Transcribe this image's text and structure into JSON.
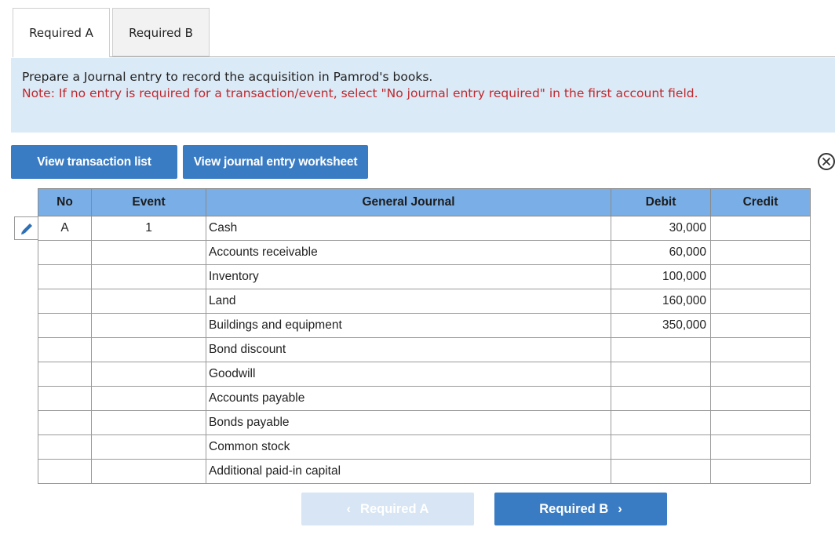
{
  "tabs": [
    {
      "label": "Required A",
      "active": true
    },
    {
      "label": "Required B",
      "active": false
    }
  ],
  "instructions": {
    "main": "Prepare a Journal entry to record the acquisition in Pamrod's books.",
    "note": "Note: If no entry is required for a transaction/event, select \"No journal entry required\" in the first account field."
  },
  "buttons": {
    "view_transaction_list": "View transaction list",
    "view_journal_entry_worksheet": "View journal entry worksheet"
  },
  "icons": {
    "close": "close-icon",
    "edit": "pencil-icon"
  },
  "journal": {
    "columns": [
      "No",
      "Event",
      "General Journal",
      "Debit",
      "Credit"
    ],
    "rows": [
      {
        "no": "A",
        "event": "1",
        "account": "Cash",
        "debit": "30,000",
        "credit": ""
      },
      {
        "no": "",
        "event": "",
        "account": "Accounts receivable",
        "debit": "60,000",
        "credit": ""
      },
      {
        "no": "",
        "event": "",
        "account": "Inventory",
        "debit": "100,000",
        "credit": ""
      },
      {
        "no": "",
        "event": "",
        "account": "Land",
        "debit": "160,000",
        "credit": ""
      },
      {
        "no": "",
        "event": "",
        "account": "Buildings and equipment",
        "debit": "350,000",
        "credit": ""
      },
      {
        "no": "",
        "event": "",
        "account": "Bond discount",
        "debit": "",
        "credit": ""
      },
      {
        "no": "",
        "event": "",
        "account": "Goodwill",
        "debit": "",
        "credit": ""
      },
      {
        "no": "",
        "event": "",
        "account": "Accounts payable",
        "debit": "",
        "credit": ""
      },
      {
        "no": "",
        "event": "",
        "account": "Bonds payable",
        "debit": "",
        "credit": ""
      },
      {
        "no": "",
        "event": "",
        "account": "Common stock",
        "debit": "",
        "credit": ""
      },
      {
        "no": "",
        "event": "",
        "account": "Additional paid-in capital",
        "debit": "",
        "credit": ""
      }
    ]
  },
  "nav": {
    "prev_label": "Required A",
    "next_label": "Required B",
    "prev_icon": "‹",
    "next_icon": "›"
  },
  "colors": {
    "primary_button": "#3a7cc4",
    "table_header": "#7aaee6",
    "instructions_bg": "#dbeaf7",
    "note_text": "#c0282d",
    "disabled_button": "#d7e5f4"
  }
}
